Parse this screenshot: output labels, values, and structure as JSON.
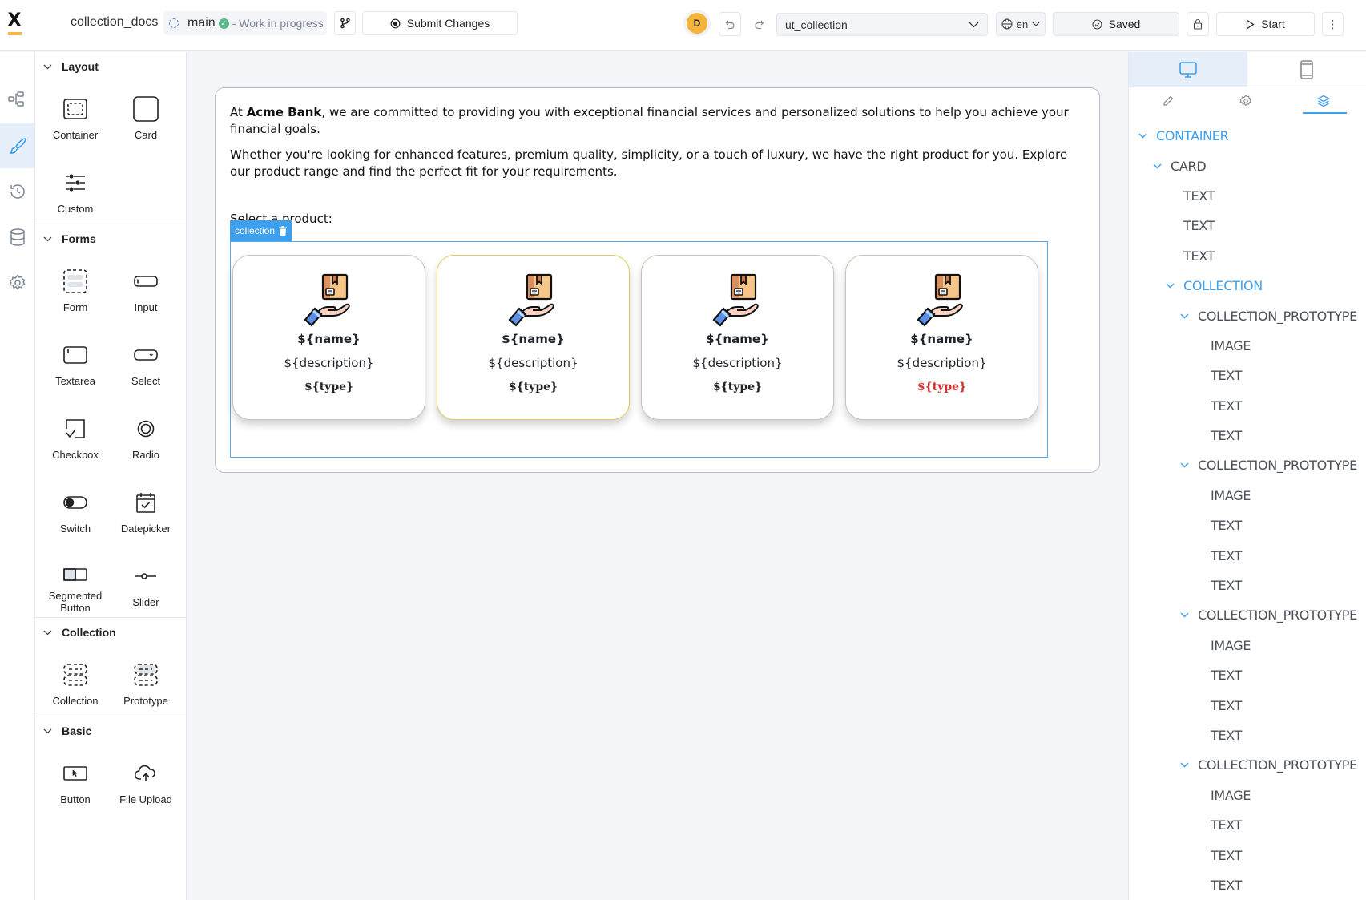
{
  "header": {
    "logo_letter": "X",
    "project_name": "collection_docs",
    "branch": "main",
    "branch_status": "- Work in progress",
    "submit_label": "Submit Changes",
    "avatar_initial": "D",
    "page_select_value": "ut_collection",
    "language": "en",
    "saved_label": "Saved",
    "start_label": "Start"
  },
  "palette": {
    "sections": [
      {
        "title": "Layout",
        "items": [
          {
            "label": "Container",
            "icon": "container-icon"
          },
          {
            "label": "Card",
            "icon": "card-icon"
          },
          {
            "label": "Custom",
            "icon": "custom-icon"
          }
        ]
      },
      {
        "title": "Forms",
        "items": [
          {
            "label": "Form",
            "icon": "form-icon"
          },
          {
            "label": "Input",
            "icon": "input-icon"
          },
          {
            "label": "Textarea",
            "icon": "textarea-icon"
          },
          {
            "label": "Select",
            "icon": "select-icon"
          },
          {
            "label": "Checkbox",
            "icon": "checkbox-icon"
          },
          {
            "label": "Radio",
            "icon": "radio-icon"
          },
          {
            "label": "Switch",
            "icon": "switch-icon"
          },
          {
            "label": "Datepicker",
            "icon": "datepicker-icon"
          },
          {
            "label": "Segmented Button",
            "icon": "segmented-button-icon"
          },
          {
            "label": "Slider",
            "icon": "slider-icon"
          }
        ]
      },
      {
        "title": "Collection",
        "items": [
          {
            "label": "Collection",
            "icon": "collection-icon"
          },
          {
            "label": "Prototype",
            "icon": "prototype-icon"
          }
        ]
      },
      {
        "title": "Basic",
        "items": [
          {
            "label": "Button",
            "icon": "button-icon"
          },
          {
            "label": "File Upload",
            "icon": "file-upload-icon"
          }
        ]
      }
    ]
  },
  "canvas": {
    "intro_prefix": "At ",
    "intro_brand": "Acme Bank",
    "intro_suffix": ", we are committed to providing you with exceptional financial services and personalized solutions to help you achieve your financial goals.",
    "paragraph2": "Whether you're looking for enhanced features, premium quality, simplicity, or a touch of luxury, we have the right product for you. Explore our product range and find the perfect fit for your requirements.",
    "select_label": "Select a product:",
    "collection_tag": "collection",
    "cards": [
      {
        "name": "${name}",
        "description": "${description}",
        "type": "${type}",
        "type_color": "#222222",
        "selected": false
      },
      {
        "name": "${name}",
        "description": "${description}",
        "type": "${type}",
        "type_color": "#222222",
        "selected": true
      },
      {
        "name": "${name}",
        "description": "${description}",
        "type": "${type}",
        "type_color": "#222222",
        "selected": false
      },
      {
        "name": "${name}",
        "description": "${description}",
        "type": "${type}",
        "type_color": "#d0312d",
        "selected": false
      }
    ]
  },
  "tree": [
    {
      "label": "CONTAINER",
      "level": 0,
      "expandable": true,
      "highlight": true
    },
    {
      "label": "CARD",
      "level": 1,
      "expandable": true,
      "highlight": false
    },
    {
      "label": "TEXT",
      "level": 2,
      "expandable": false,
      "highlight": false
    },
    {
      "label": "TEXT",
      "level": 2,
      "expandable": false,
      "highlight": false
    },
    {
      "label": "TEXT",
      "level": 2,
      "expandable": false,
      "highlight": false
    },
    {
      "label": "COLLECTION",
      "level": 2,
      "expandable": true,
      "highlight": true
    },
    {
      "label": "COLLECTION_PROTOTYPE",
      "level": 3,
      "expandable": true,
      "highlight": false
    },
    {
      "label": "IMAGE",
      "level": 4,
      "expandable": false,
      "highlight": false
    },
    {
      "label": "TEXT",
      "level": 4,
      "expandable": false,
      "highlight": false
    },
    {
      "label": "TEXT",
      "level": 4,
      "expandable": false,
      "highlight": false
    },
    {
      "label": "TEXT",
      "level": 4,
      "expandable": false,
      "highlight": false
    },
    {
      "label": "COLLECTION_PROTOTYPE",
      "level": 3,
      "expandable": true,
      "highlight": false
    },
    {
      "label": "IMAGE",
      "level": 4,
      "expandable": false,
      "highlight": false
    },
    {
      "label": "TEXT",
      "level": 4,
      "expandable": false,
      "highlight": false
    },
    {
      "label": "TEXT",
      "level": 4,
      "expandable": false,
      "highlight": false
    },
    {
      "label": "TEXT",
      "level": 4,
      "expandable": false,
      "highlight": false
    },
    {
      "label": "COLLECTION_PROTOTYPE",
      "level": 3,
      "expandable": true,
      "highlight": false
    },
    {
      "label": "IMAGE",
      "level": 4,
      "expandable": false,
      "highlight": false
    },
    {
      "label": "TEXT",
      "level": 4,
      "expandable": false,
      "highlight": false
    },
    {
      "label": "TEXT",
      "level": 4,
      "expandable": false,
      "highlight": false
    },
    {
      "label": "TEXT",
      "level": 4,
      "expandable": false,
      "highlight": false
    },
    {
      "label": "COLLECTION_PROTOTYPE",
      "level": 3,
      "expandable": true,
      "highlight": false
    },
    {
      "label": "IMAGE",
      "level": 4,
      "expandable": false,
      "highlight": false
    },
    {
      "label": "TEXT",
      "level": 4,
      "expandable": false,
      "highlight": false
    },
    {
      "label": "TEXT",
      "level": 4,
      "expandable": false,
      "highlight": false
    },
    {
      "label": "TEXT",
      "level": 4,
      "expandable": false,
      "highlight": false
    }
  ],
  "colors": {
    "accent": "#3da0ee",
    "avatar": "#f5b33b",
    "selected_card_border": "#e2c95c",
    "logo_bar": "#f5b841"
  }
}
